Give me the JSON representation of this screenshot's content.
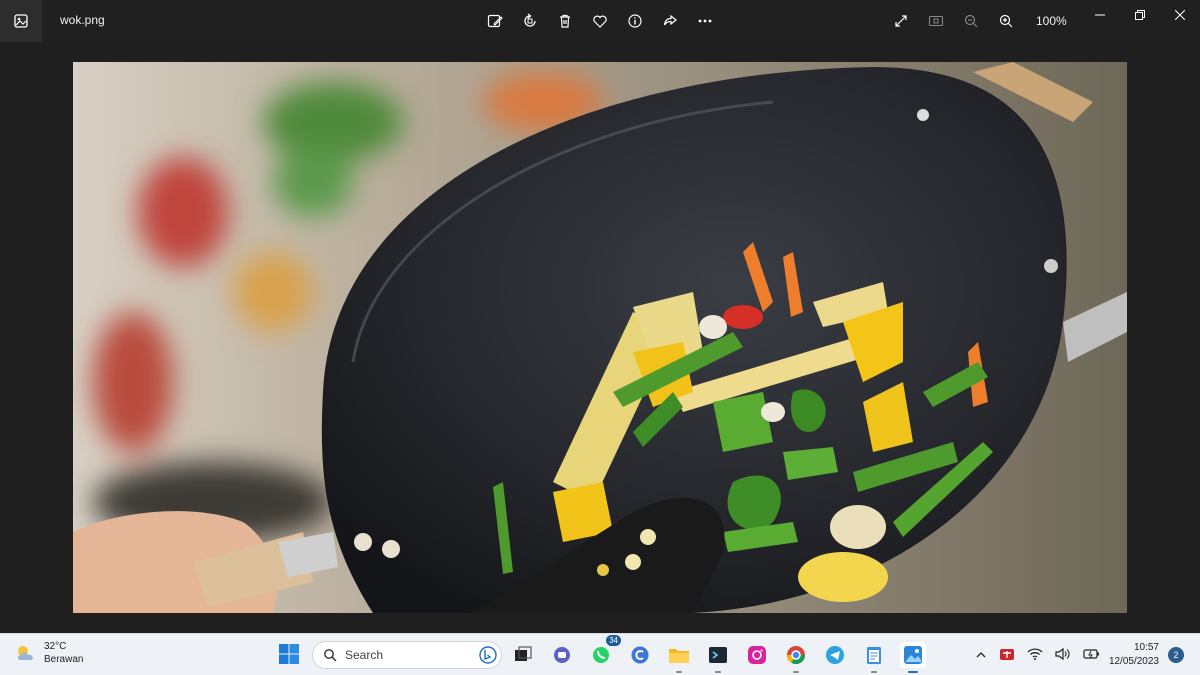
{
  "window": {
    "filename": "wok.png",
    "zoom": "100%"
  },
  "toolbar": {
    "icons": [
      "edit-image-icon",
      "rotate-icon",
      "delete-icon",
      "favorite-icon",
      "info-icon",
      "share-icon",
      "more-icon"
    ],
    "right_icons": [
      "fullscreen-icon",
      "fit-icon",
      "zoom-out-icon",
      "zoom-in-icon"
    ]
  },
  "taskbar": {
    "weather": {
      "temp": "32°C",
      "condition": "Berawan"
    },
    "search_placeholder": "Search",
    "whatsapp_badge": "34",
    "clock": {
      "time": "10:57",
      "date": "12/05/2023"
    },
    "notification_count": "2"
  },
  "colors": {
    "background": "#1f1f1f",
    "titlebar": "#202020",
    "taskbar": "#eef2f7"
  }
}
